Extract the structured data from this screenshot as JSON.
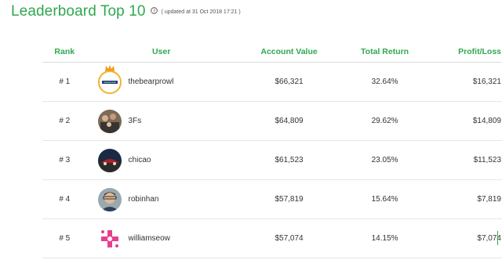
{
  "title": "Leaderboard Top 10",
  "updated": "( updated at 31 Oct 2018 17:21 )",
  "help_icon": "question-circle-icon",
  "accent_color": "#2fa84f",
  "columns": {
    "rank": "Rank",
    "user": "User",
    "account_value": "Account Value",
    "total_return": "Total Return",
    "profit_loss": "Profit/Loss"
  },
  "rows": [
    {
      "rank": "# 1",
      "user": "thebearprowl",
      "account_value": "$66,321",
      "total_return": "32.64%",
      "profit_loss": "$16,321",
      "avatar": "bear-logo-with-crown",
      "avatar_text": "bearprowl"
    },
    {
      "rank": "# 2",
      "user": "3Fs",
      "account_value": "$64,809",
      "total_return": "29.62%",
      "profit_loss": "$14,809",
      "avatar": "group-photo"
    },
    {
      "rank": "# 3",
      "user": "chicao",
      "account_value": "$61,523",
      "total_return": "23.05%",
      "profit_loss": "$11,523",
      "avatar": "car-photo"
    },
    {
      "rank": "# 4",
      "user": "robinhan",
      "account_value": "$57,819",
      "total_return": "15.64%",
      "profit_loss": "$7,819",
      "avatar": "portrait-photo"
    },
    {
      "rank": "# 5",
      "user": "williamseow",
      "account_value": "$57,074",
      "total_return": "14.15%",
      "profit_loss": "$7,074",
      "avatar": "pink-cross-logo"
    }
  ]
}
